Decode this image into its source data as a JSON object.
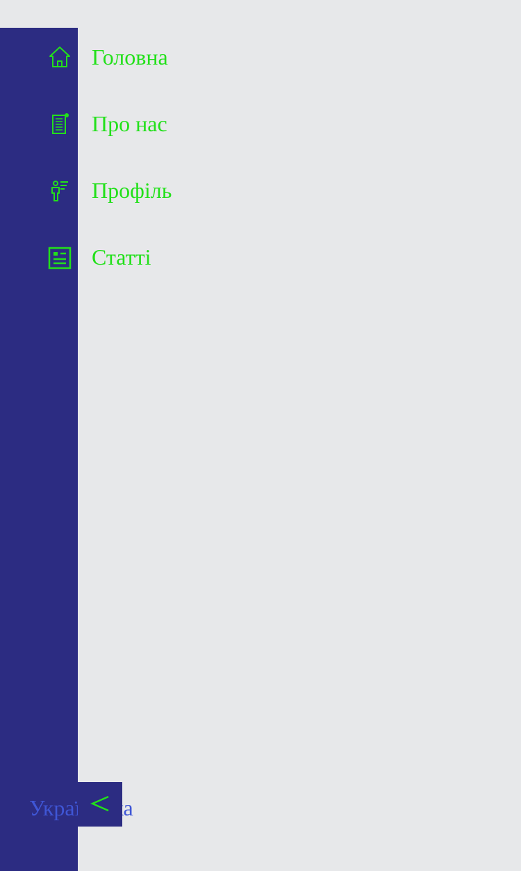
{
  "colors": {
    "page_bg": "#e7e8ea",
    "sidebar_bg": "#2c2c82",
    "nav_text": "#22e01a",
    "lang_text": "#3f56d6"
  },
  "sidebar": {
    "items": [
      {
        "label": "Головна",
        "icon": "home-icon"
      },
      {
        "label": "Про нас",
        "icon": "document-icon"
      },
      {
        "label": "Профіль",
        "icon": "profile-icon"
      },
      {
        "label": "Статті",
        "icon": "article-icon"
      }
    ]
  },
  "footer": {
    "language": "Українська",
    "collapse_icon": "chevron-left-icon"
  }
}
